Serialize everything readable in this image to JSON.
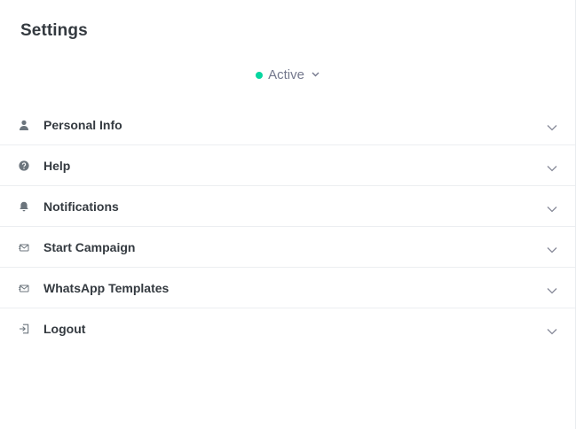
{
  "header": {
    "title": "Settings"
  },
  "status": {
    "label": "Active",
    "dot_color": "#06d6a0",
    "chevron_icon": "chevron-down-icon"
  },
  "menu": {
    "items": [
      {
        "label": "Personal Info",
        "icon": "user-icon"
      },
      {
        "label": "Help",
        "icon": "help-circle-icon"
      },
      {
        "label": "Notifications",
        "icon": "bell-icon"
      },
      {
        "label": "Start Campaign",
        "icon": "mail-send-icon"
      },
      {
        "label": "WhatsApp Templates",
        "icon": "mail-send-icon"
      },
      {
        "label": "Logout",
        "icon": "logout-icon"
      }
    ]
  }
}
